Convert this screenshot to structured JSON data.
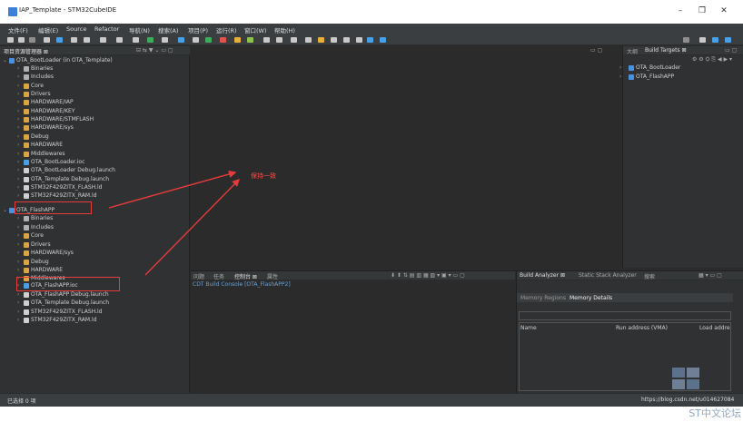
{
  "window": {
    "title": "IAP_Template - STM32CubeIDE",
    "controls": [
      "–",
      "❐",
      "✕"
    ]
  },
  "menu": [
    "文件(F)",
    "编辑(E)",
    "Source",
    "Refactor",
    "导航(N)",
    "搜索(A)",
    "项目(P)",
    "运行(R)",
    "窗口(W)",
    "帮助(H)"
  ],
  "left_panel": {
    "title": "项目资源管理器 ⊠",
    "tree": [
      {
        "label": "OTA_BootLoader (in OTA_Template)",
        "icon": "project-icon",
        "level": 0
      },
      {
        "label": "Binaries",
        "icon": "binaries-icon",
        "level": 1
      },
      {
        "label": "Includes",
        "icon": "includes-icon",
        "level": 1
      },
      {
        "label": "Core",
        "icon": "folder-icon",
        "level": 1
      },
      {
        "label": "Drivers",
        "icon": "folder-icon",
        "level": 1
      },
      {
        "label": "HARDWARE/IAP",
        "icon": "folder-icon",
        "level": 1
      },
      {
        "label": "HARDWARE/KEY",
        "icon": "folder-icon",
        "level": 1
      },
      {
        "label": "HARDWARE/STMFLASH",
        "icon": "folder-icon",
        "level": 1
      },
      {
        "label": "HARDWARE/sys",
        "icon": "folder-icon",
        "level": 1
      },
      {
        "label": "Debug",
        "icon": "folder-icon",
        "level": 1
      },
      {
        "label": "HARDWARE",
        "icon": "folder-icon",
        "level": 1
      },
      {
        "label": "Middlewares",
        "icon": "folder-icon",
        "level": 1
      },
      {
        "label": "OTA_BootLoader.ioc",
        "icon": "ioc-icon",
        "level": 1
      },
      {
        "label": "OTA_BootLoader Debug.launch",
        "icon": "launch-icon",
        "level": 1
      },
      {
        "label": "OTA_Template Debug.launch",
        "icon": "launch-icon",
        "level": 1
      },
      {
        "label": "STM32F429ZITX_FLASH.ld",
        "icon": "file-icon",
        "level": 1
      },
      {
        "label": "STM32F429ZITX_RAM.ld",
        "icon": "file-icon",
        "level": 1
      },
      {
        "label": "OTA_FlashAPP",
        "icon": "project-icon",
        "level": 0
      },
      {
        "label": "Binaries",
        "icon": "binaries-icon",
        "level": 1
      },
      {
        "label": "Includes",
        "icon": "includes-icon",
        "level": 1
      },
      {
        "label": "Core",
        "icon": "folder-icon",
        "level": 1
      },
      {
        "label": "Drivers",
        "icon": "folder-icon",
        "level": 1
      },
      {
        "label": "HARDWARE/sys",
        "icon": "folder-icon",
        "level": 1
      },
      {
        "label": "Debug",
        "icon": "folder-icon",
        "level": 1
      },
      {
        "label": "HARDWARE",
        "icon": "folder-icon",
        "level": 1
      },
      {
        "label": "Middlewares",
        "icon": "folder-icon",
        "level": 1
      },
      {
        "label": "OTA_FlashAPP.ioc",
        "icon": "ioc-icon",
        "level": 1
      },
      {
        "label": "OTA_FlashAPP Debug.launch",
        "icon": "launch-icon",
        "level": 1
      },
      {
        "label": "OTA_Template Debug.launch",
        "icon": "launch-icon",
        "level": 1
      },
      {
        "label": "STM32F429ZITX_FLASH.ld",
        "icon": "file-icon",
        "level": 1
      },
      {
        "label": "STM32F429ZITX_RAM.ld",
        "icon": "file-icon",
        "level": 1
      }
    ]
  },
  "right_panel": {
    "tabs": [
      "大纲",
      "Build Targets ⊠"
    ],
    "items": [
      "OTA_BootLoader",
      "OTA_FlashAPP"
    ]
  },
  "console": {
    "tabs": [
      "问题",
      "任务",
      "控制台 ⊠",
      "属性"
    ],
    "text": "CDT Build Console [OTA_FlashAPP2]"
  },
  "analyzer": {
    "tabs": [
      "Build Analyzer ⊠",
      "Static Stack Analyzer",
      "搜索"
    ],
    "sub_tabs": [
      "Memory Regions",
      "Memory Details"
    ],
    "columns": [
      "Name",
      "Run address (VMA)",
      "Load addre"
    ]
  },
  "status": {
    "left": "已选择 0 项",
    "right": "https://blog.csdn.net/u014627084"
  },
  "annotation": {
    "label": "保持一致",
    "color": "#e53b3b"
  },
  "watermark": "ST中文论坛"
}
